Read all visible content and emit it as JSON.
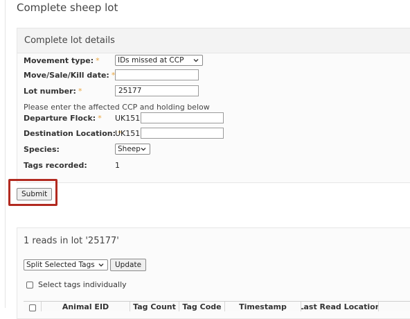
{
  "page": {
    "title": "Complete sheep lot"
  },
  "lot_details": {
    "header": "Complete lot details",
    "movement_type": {
      "label": "Movement type:",
      "value": "IDs missed at CCP"
    },
    "move_date": {
      "label": "Move/Sale/Kill date:",
      "value": ""
    },
    "lot_number": {
      "label": "Lot number:",
      "value": "25177"
    },
    "note": "Please enter the affected CCP and holding below",
    "departure_flock": {
      "label": "Departure Flock:",
      "prefix": "UK151",
      "value": ""
    },
    "destination_location": {
      "label": "Destination Location:",
      "prefix": "UK151",
      "value": ""
    },
    "species": {
      "label": "Species:",
      "value": "Sheep"
    },
    "tags_recorded": {
      "label": "Tags recorded:",
      "value": "1"
    },
    "required_marker": "*"
  },
  "actions": {
    "submit_label": "Submit"
  },
  "reads": {
    "header": "1 reads in lot '25177'",
    "split_select_value": "Split Selected Tags",
    "update_label": "Update",
    "select_individually_label": "Select tags individually",
    "columns": [
      "Animal EID",
      "Tag Count",
      "Tag Code",
      "Timestamp",
      "Last Read Location"
    ]
  },
  "colors": {
    "highlight": "#b22a20",
    "required": "#e8a43d"
  }
}
